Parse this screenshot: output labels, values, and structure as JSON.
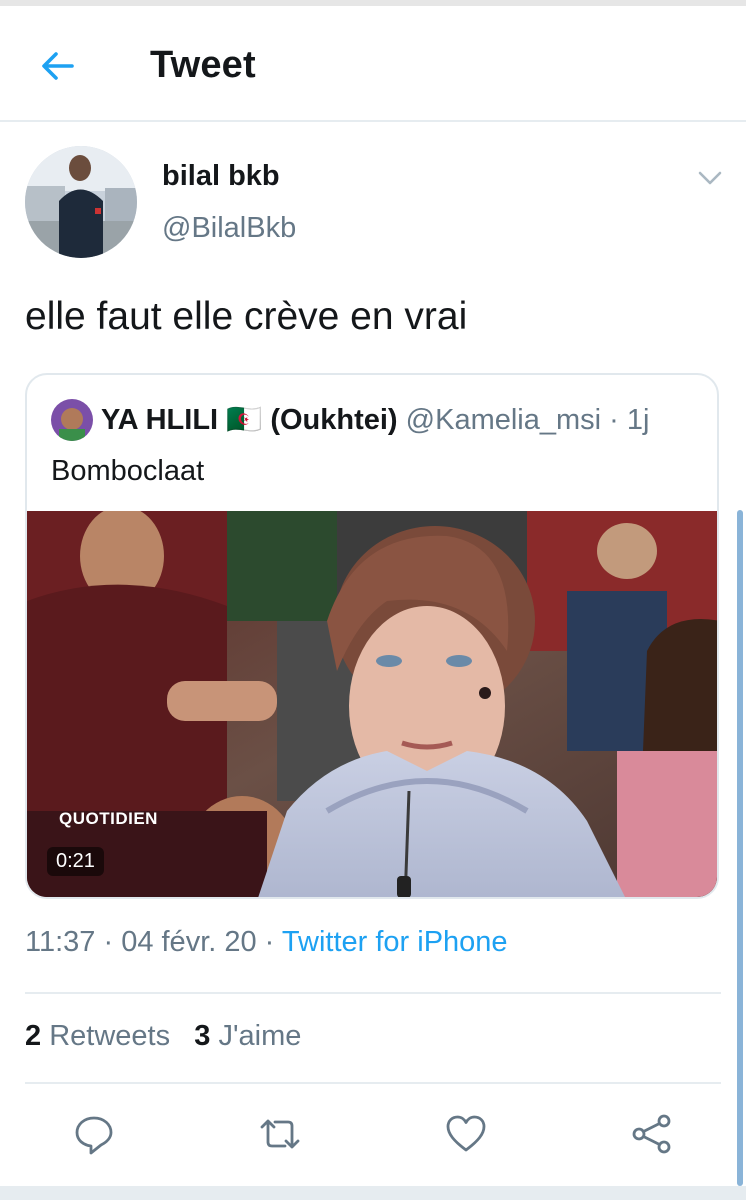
{
  "header": {
    "title": "Tweet",
    "back_icon": "arrow-left-icon",
    "accent": "#1da1f2"
  },
  "tweet": {
    "author_name": "bilal bkb",
    "author_handle": "@BilalBkb",
    "text": "elle faut elle crève en vrai",
    "more_icon": "chevron-down-icon",
    "timestamp": "11:37 · 04 févr. 20 ·",
    "source": "Twitter for iPhone"
  },
  "quoted": {
    "author_name": "YA HLILI 🇩🇿 (Oukhtei)",
    "author_handle": "@Kamelia_msi",
    "time": "· 1j",
    "text": "Bomboclaat",
    "video_duration": "0:21",
    "video_logo": "QUOTIDIEN"
  },
  "stats": {
    "retweets_count": "2",
    "retweets_label": "Retweets",
    "likes_count": "3",
    "likes_label": "J'aime"
  },
  "actions": [
    "reply-icon",
    "retweet-icon",
    "like-icon",
    "share-icon"
  ],
  "colors": {
    "secondary_text": "#657786",
    "divider": "#e6ecf0",
    "link": "#1da1f2"
  }
}
